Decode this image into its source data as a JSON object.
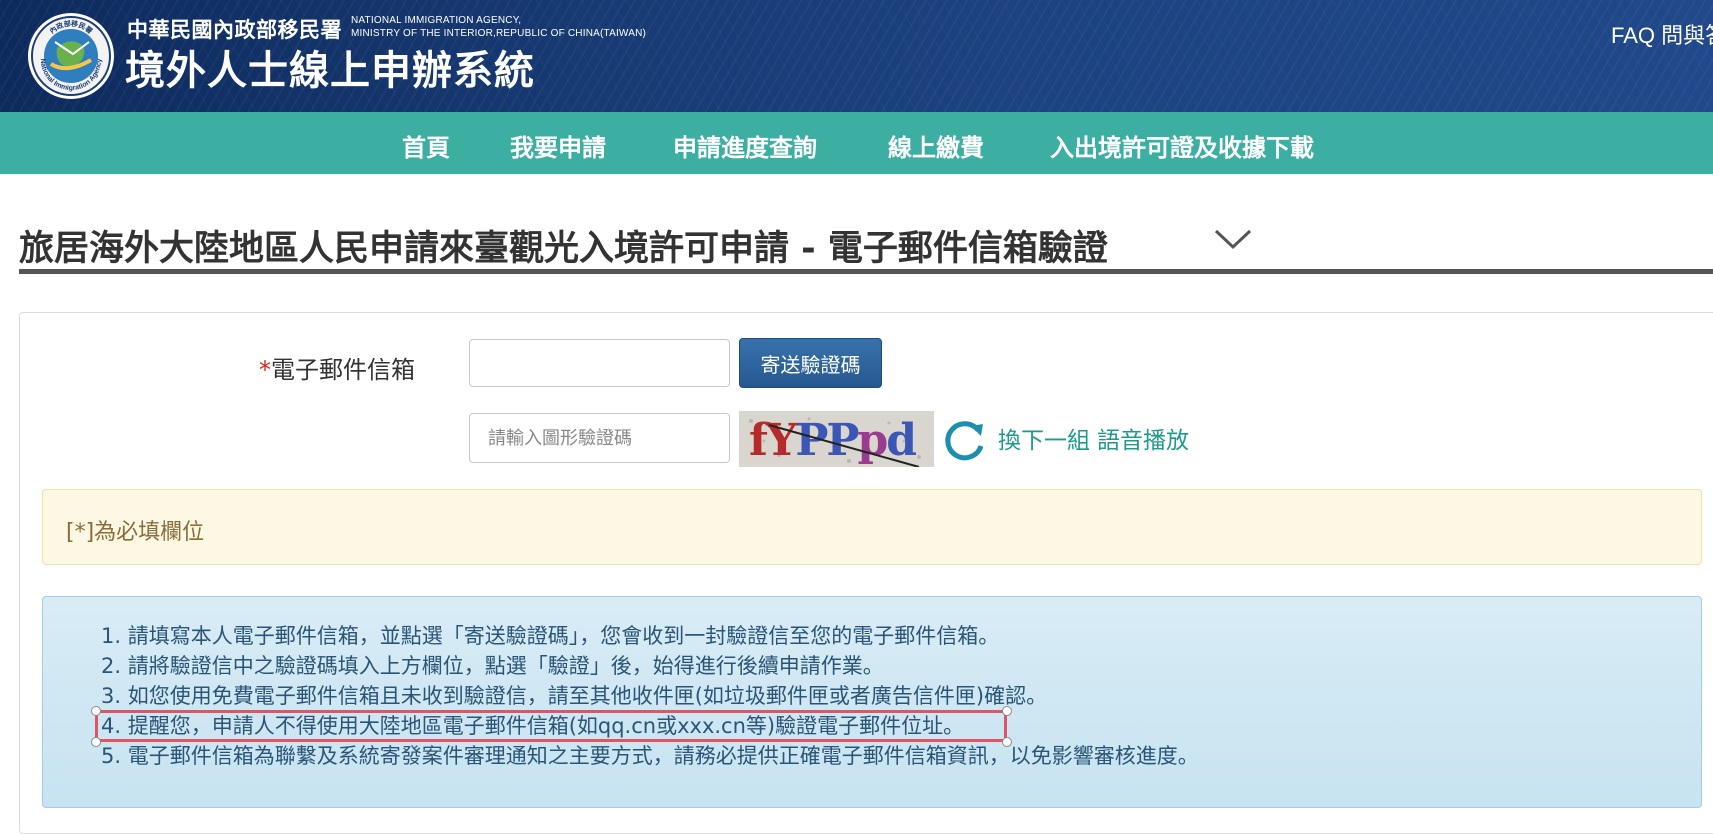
{
  "header": {
    "agency_zh": "中華民國內政部移民署",
    "agency_en_line1": "NATIONAL IMMIGRATION AGENCY,",
    "agency_en_line2": "MINISTRY OF THE INTERIOR,REPUBLIC OF CHINA(TAIWAN)",
    "system_title": "境外人士線上申辦系統",
    "faq_link": "FAQ 問與答",
    "logo_text": "National Immigration Agency",
    "logo_text_zh": "內政部移民署"
  },
  "nav": {
    "items": [
      "首頁",
      "我要申請",
      "申請進度查詢",
      "線上繳費",
      "入出境許可證及收據下載"
    ]
  },
  "page": {
    "title": "旅居海外大陸地區人民申請來臺觀光入境許可申請 - 電子郵件信箱驗證"
  },
  "form": {
    "required_mark": "*",
    "email_label": "電子郵件信箱",
    "email_value": "",
    "send_button": "寄送驗證碼",
    "captcha_placeholder": "請輸入圖形驗證碼",
    "captcha_text": "fYPPpd",
    "captcha_next": "換下一組",
    "captcha_audio": "語音播放"
  },
  "required_note": "[*]為必填欄位",
  "instructions": [
    "1. 請填寫本人電子郵件信箱，並點選「寄送驗證碼」，您會收到一封驗證信至您的電子郵件信箱。",
    "2. 請將驗證信中之驗證碼填入上方欄位，點選「驗證」後，始得進行後續申請作業。",
    "3. 如您使用免費電子郵件信箱且未收到驗證信，請至其他收件匣(如垃圾郵件匣或者廣告信件匣)確認。",
    "4. 提醒您，申請人不得使用大陸地區電子郵件信箱(如qq.cn或xxx.cn等)驗證電子郵件位址。",
    "5. 電子郵件信箱為聯繫及系統寄發案件審理通知之主要方式，請務必提供正確電子郵件信箱資訊，以免影響審核進度。"
  ],
  "icons": {
    "logo": "agency-seal-icon",
    "chevron": "chevron-down-icon",
    "refresh": "refresh-icon"
  },
  "colors": {
    "header_bg": "#173a73",
    "nav_bg": "#3dafa2",
    "button_bg": "#2b6196",
    "link": "#1e9a8a",
    "warning_bg": "#fcf8e3",
    "info_bg": "#d8ecf6",
    "highlight": "#e05463"
  }
}
